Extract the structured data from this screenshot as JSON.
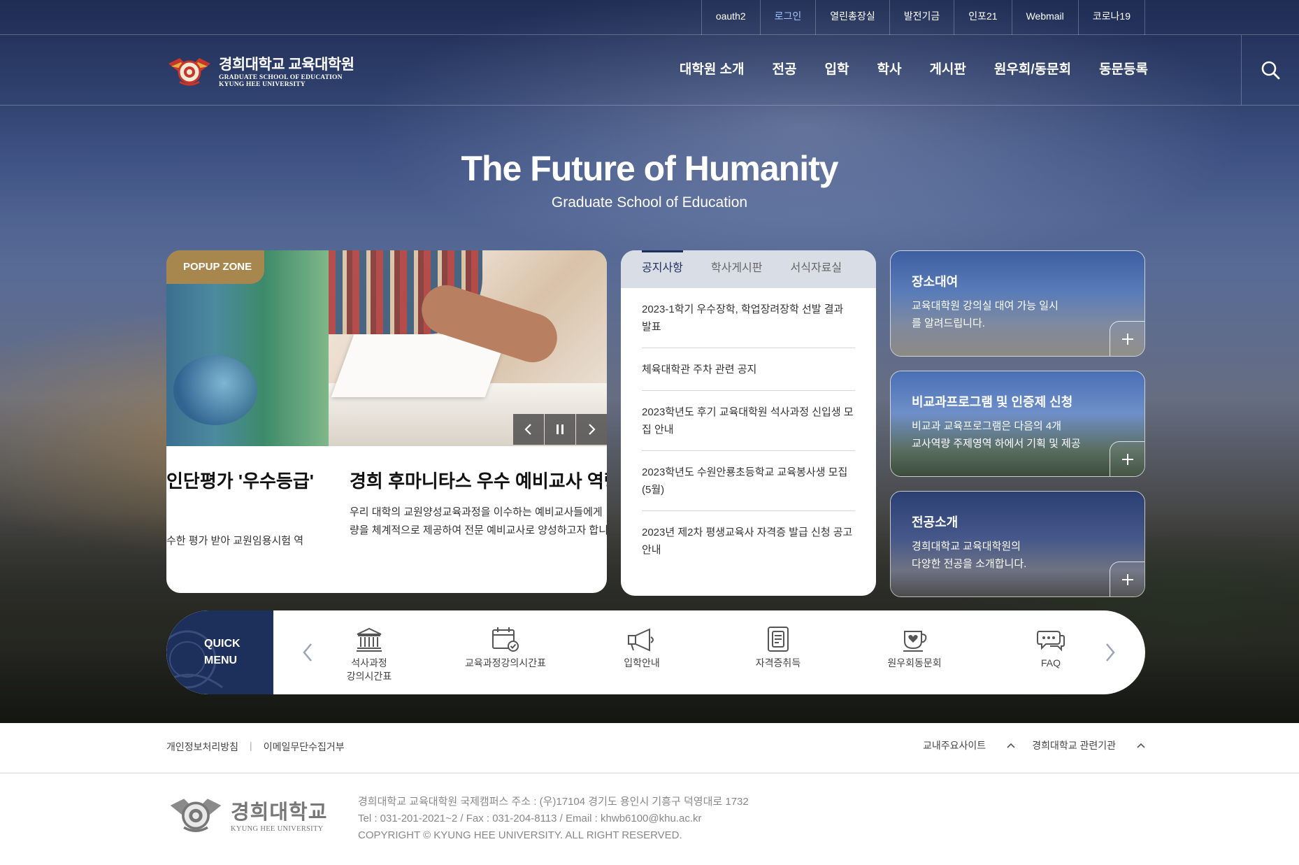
{
  "utility_nav": [
    "oauth2",
    "로그인",
    "열린총장실",
    "발전기금",
    "인포21",
    "Webmail",
    "코로나19"
  ],
  "header": {
    "logo_ko": "경희대학교 교육대학원",
    "logo_en_1": "GRADUATE SCHOOL OF EDUCATION",
    "logo_en_2": "KYUNG HEE UNIVERSITY",
    "gnb": [
      "대학원 소개",
      "전공",
      "입학",
      "학사",
      "게시판",
      "원우회/동문회",
      "동문등록"
    ],
    "search_icon": "search-icon"
  },
  "hero": {
    "title": "The Future of Humanity",
    "subtitle": "Graduate School of Education"
  },
  "popup": {
    "tag": "POPUP ZONE",
    "slide1_title": "인단평가 '우수등급'",
    "slide1_desc": "수한 평가 받아 교원임용시험 역",
    "slide2_title": "경희 후마니타스 우수 예비교사 역량",
    "slide2_desc_1": "우리 대학의 교원양성교육과정을 이수하는 예비교사들에게",
    "slide2_desc_2": "량을 체계적으로 제공하여 전문 예비교사로 양성하고자 합니",
    "controls": [
      "prev-icon",
      "pause-icon",
      "next-icon"
    ]
  },
  "notice": {
    "tabs": [
      "공지사항",
      "학사게시판",
      "서식자료실"
    ],
    "active_tab": 0,
    "items": [
      "2023-1학기 우수장학, 학업장려장학 선발 결과 발표",
      "체육대학관 주차 관련 공지",
      "2023학년도 후기 교육대학원 석사과정 신입생 모집 안내",
      "2023학년도 수원안룡초등학교 교육봉사생 모집 (5월)",
      "2023년 제2차 평생교육사 자격증 발급 신청 공고 안내"
    ]
  },
  "banners": [
    {
      "title": "장소대여",
      "desc": "교육대학원 강의실 대여 가능 일시\n를 알려드립니다."
    },
    {
      "title": "비교과프로그램 및 인증제 신청",
      "desc": "비교과 교육프로그램은 다음의 4개\n교사역량 주제영역 하에서 기획 및 제공"
    },
    {
      "title": "전공소개",
      "desc": "경희대학교 교육대학원의\n다양한 전공을 소개합니다."
    }
  ],
  "quick_menu": {
    "label_1": "QUICK",
    "label_2": "MENU",
    "items": [
      {
        "label": "석사과정\n강의시간표",
        "icon": "institution-icon"
      },
      {
        "label": "교육과정강의시간표",
        "icon": "calendar-check-icon"
      },
      {
        "label": "입학안내",
        "icon": "megaphone-icon"
      },
      {
        "label": "자격증취득",
        "icon": "certificate-icon"
      },
      {
        "label": "원우회동문회",
        "icon": "heart-cup-icon"
      },
      {
        "label": "FAQ",
        "icon": "chat-bubbles-icon"
      }
    ]
  },
  "footer": {
    "links": [
      "개인정보처리방침",
      "이메일무단수집거부"
    ],
    "sites": [
      "교내주요사이트",
      "경희대학교 관련기관"
    ],
    "logo_ko": "경희대학교",
    "logo_en": "KYUNG HEE UNIVERSITY",
    "address": "경희대학교 교육대학원 국제캠퍼스 주소 : (우)17104 경기도 용인시 기흥구 덕영대로 1732",
    "contact": "Tel : 031-201-2021~2 / Fax : 031-204-8113 / Email : khwb6100@khu.ac.kr",
    "copyright": "COPYRIGHT © KYUNG HEE UNIVERSITY. ALL RIGHT RESERVED."
  },
  "colors": {
    "navy": "#1d2f5b",
    "gold": "#a8874f",
    "login_active": "#9fc2ff"
  }
}
